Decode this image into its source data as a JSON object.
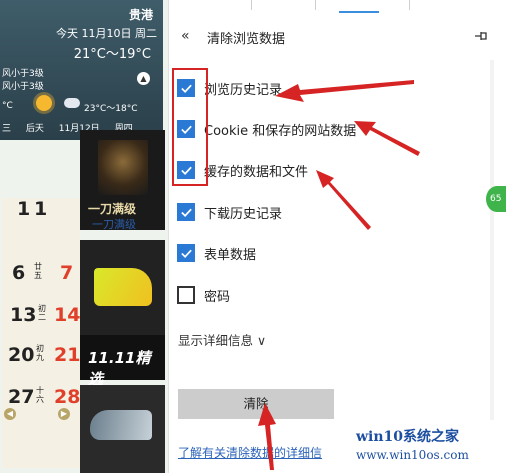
{
  "panel": {
    "back_icon": "«",
    "title": "清除浏览数据",
    "pin_icon": "pin-icon",
    "options": [
      {
        "label": "浏览历史记录",
        "checked": true
      },
      {
        "label": "Cookie 和保存的网站数据",
        "checked": true
      },
      {
        "label": "缓存的数据和文件",
        "checked": true
      },
      {
        "label": "下载历史记录",
        "checked": true
      },
      {
        "label": "表单数据",
        "checked": true
      },
      {
        "label": "密码",
        "checked": false
      }
    ],
    "details_link": "显示详细信息",
    "details_chevron": "∨",
    "clear_button": "清除",
    "learn_more_link": "了解有关清除数据的详细信"
  },
  "weather": {
    "city": "贵港",
    "date_line": "今天  11月10日  周二",
    "temp": "21°C～19°C",
    "wind_1": "风小于3级",
    "wind_2": "风小于3级",
    "temp_2": "°C",
    "temp_3": "23°C～18°C",
    "day_3": "后天",
    "date_3": "11月12日",
    "weekday_3": "周四",
    "row_prefix": "三"
  },
  "game": {
    "logo": "一刀满级",
    "label": "一刀满级"
  },
  "calendar": {
    "month": [
      "1",
      "1"
    ],
    "rows": [
      {
        "day": "6",
        "lunar": "廿五",
        "day2": "7"
      },
      {
        "day": "13",
        "lunar": "初二",
        "day2": "14"
      },
      {
        "day": "20",
        "lunar": "初九",
        "day2": "21"
      },
      {
        "day": "27",
        "lunar": "十六",
        "day2": "28"
      }
    ]
  },
  "ads": {
    "sale_text": "11.11精选"
  },
  "badge": {
    "text": "65"
  },
  "watermark": {
    "title": "win10系统之家",
    "url": "www.win10os.com"
  },
  "colors": {
    "checkbox": "#2a7ad5",
    "annotation_red": "#d62424",
    "link": "#2b63b8"
  }
}
